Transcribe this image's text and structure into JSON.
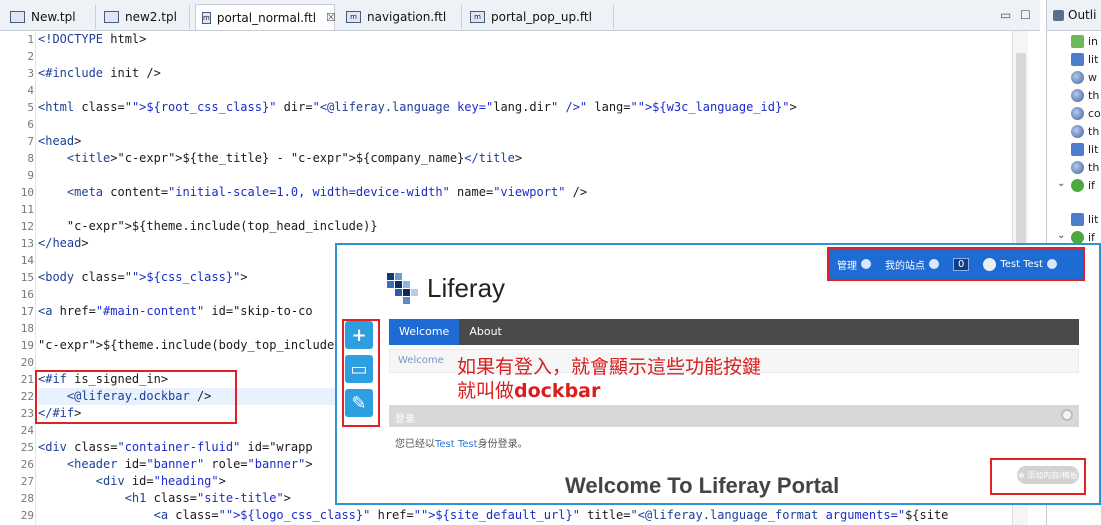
{
  "tabs": [
    {
      "label": "New.tpl",
      "icon": "window-icon"
    },
    {
      "label": "new2.tpl",
      "icon": "window-icon"
    },
    {
      "label": "portal_normal.ftl",
      "icon": "ftl-file-icon",
      "active": true,
      "close": "☒"
    },
    {
      "label": "navigation.ftl",
      "icon": "ftl-file-icon"
    },
    {
      "label": "portal_pop_up.ftl",
      "icon": "ftl-file-icon"
    }
  ],
  "window_controls": {
    "minimize": "▭",
    "maximize": "☐"
  },
  "outline": {
    "title": "Outli",
    "items": [
      "in",
      "lit",
      "w",
      "th",
      "co",
      "th",
      "lit",
      "th",
      "if",
      "lit",
      "if"
    ]
  },
  "code_lines": [
    {
      "n": "1",
      "text": "<!DOCTYPE html>"
    },
    {
      "n": "2",
      "text": ""
    },
    {
      "n": "3",
      "text": "<#include init />"
    },
    {
      "n": "4",
      "text": ""
    },
    {
      "n": "5",
      "text": "<html class=\"${root_css_class}\" dir=\"<@liferay.language key=\"lang.dir\" />\" lang=\"${w3c_language_id}\">"
    },
    {
      "n": "6",
      "text": ""
    },
    {
      "n": "7",
      "text": "<head>"
    },
    {
      "n": "8",
      "text": "    <title>${the_title} - ${company_name}</title>"
    },
    {
      "n": "9",
      "text": ""
    },
    {
      "n": "10",
      "text": "    <meta content=\"initial-scale=1.0, width=device-width\" name=\"viewport\" />"
    },
    {
      "n": "11",
      "text": ""
    },
    {
      "n": "12",
      "text": "    ${theme.include(top_head_include)}"
    },
    {
      "n": "13",
      "text": "</head>"
    },
    {
      "n": "14",
      "text": ""
    },
    {
      "n": "15",
      "text": "<body class=\"${css_class}\">"
    },
    {
      "n": "16",
      "text": ""
    },
    {
      "n": "17",
      "text": "<a href=\"#main-content\" id=\"skip-to-co"
    },
    {
      "n": "18",
      "text": ""
    },
    {
      "n": "19",
      "text": "${theme.include(body_top_include)}"
    },
    {
      "n": "20",
      "text": ""
    },
    {
      "n": "21",
      "text": "<#if is_signed_in>"
    },
    {
      "n": "22",
      "text": "    <@liferay.dockbar />"
    },
    {
      "n": "23",
      "text": "</#if>"
    },
    {
      "n": "24",
      "text": ""
    },
    {
      "n": "25",
      "text": "<div class=\"container-fluid\" id=\"wrapp"
    },
    {
      "n": "26",
      "text": "    <header id=\"banner\" role=\"banner\">"
    },
    {
      "n": "27",
      "text": "        <div id=\"heading\">"
    },
    {
      "n": "28",
      "text": "            <h1 class=\"site-title\">"
    },
    {
      "n": "29",
      "text": "                <a class=\"${logo_css_class}\" href=\"${site_default_url}\" title=\"<@liferay.language_format arguments=\"${site"
    }
  ],
  "portal": {
    "dockbar_top": {
      "menu1": "管理",
      "menu2": "我的站点",
      "count": "0",
      "user": "Test Test"
    },
    "dockbar_left": {
      "add": "+",
      "preview": "▭",
      "edit": "✎"
    },
    "site_name": "Liferay",
    "nav": {
      "welcome": "Welcome",
      "about": "About"
    },
    "breadcrumb": "Welcome",
    "annotation_line1": "如果有登入，就會顯示這些功能按鍵",
    "annotation_line2_prefix": "就叫做",
    "annotation_line2_bold": "dockbar",
    "portlet_title": "登录",
    "portlet_body_prefix": "您已经以",
    "portlet_body_link": "Test Test",
    "portlet_body_suffix": "身份登录。",
    "welcome_heading": "Welcome To Liferay Portal",
    "corner_button": "⊕ 添加内容/模板"
  },
  "colors": {
    "accent": "#1e6bd3",
    "annotation": "#e02222",
    "frame": "#2d93d4"
  }
}
